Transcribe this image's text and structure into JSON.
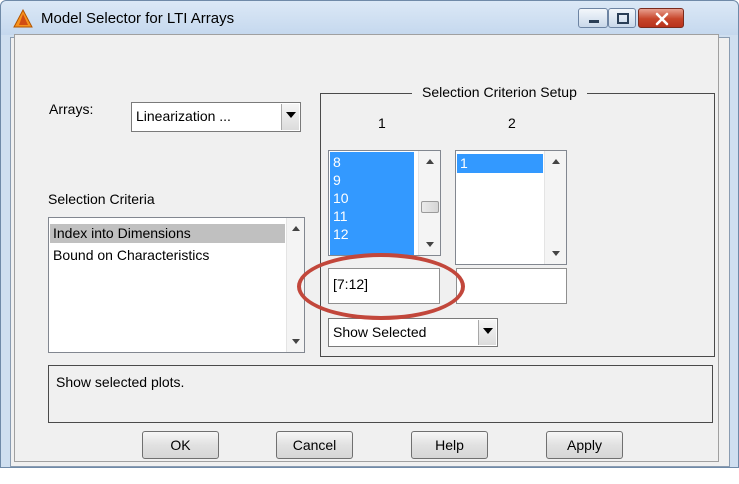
{
  "window": {
    "title": "Model Selector for LTI Arrays",
    "controls": [
      "minimize-icon",
      "maximize-icon",
      "close-icon"
    ]
  },
  "arrays": {
    "label": "Arrays:",
    "selected": "Linearization ..."
  },
  "selection_criteria": {
    "label": "Selection Criteria",
    "items": [
      "Index into Dimensions",
      "Bound on Characteristics"
    ],
    "selected_index": 0
  },
  "setup": {
    "title": "Selection Criterion Setup",
    "columns": [
      {
        "header": "1",
        "items": [
          "8",
          "9",
          "10",
          "11",
          "12"
        ],
        "field_value": "[7:12]"
      },
      {
        "header": "2",
        "items": [
          "1"
        ],
        "field_value": ""
      }
    ],
    "show_option": "Show Selected"
  },
  "message": "Show selected plots.",
  "buttons": {
    "ok": "OK",
    "cancel": "Cancel",
    "help": "Help",
    "apply": "Apply"
  },
  "colors": {
    "selection_blue": "#3399ff",
    "list_selection_gray": "#c0c0c0",
    "highlight_circle": "#c2473b",
    "close_button": "#c7452a"
  }
}
